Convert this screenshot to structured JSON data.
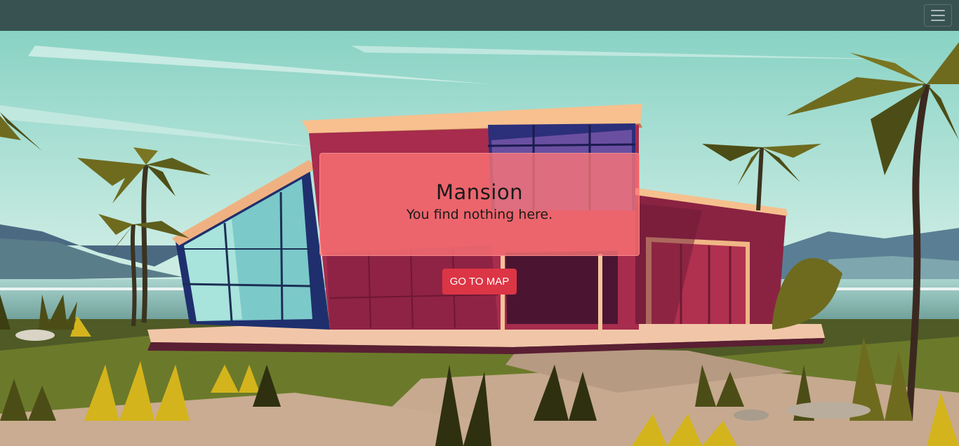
{
  "navbar": {
    "toggler_icon": "hamburger-menu-icon"
  },
  "location": {
    "title": "Mansion",
    "description": "You find nothing here."
  },
  "actions": {
    "map_button_label": "GO TO MAP"
  },
  "colors": {
    "navbar": "#324848",
    "card": "#ff7676",
    "button": "#dc3545",
    "sky": "#8fd4c6"
  }
}
